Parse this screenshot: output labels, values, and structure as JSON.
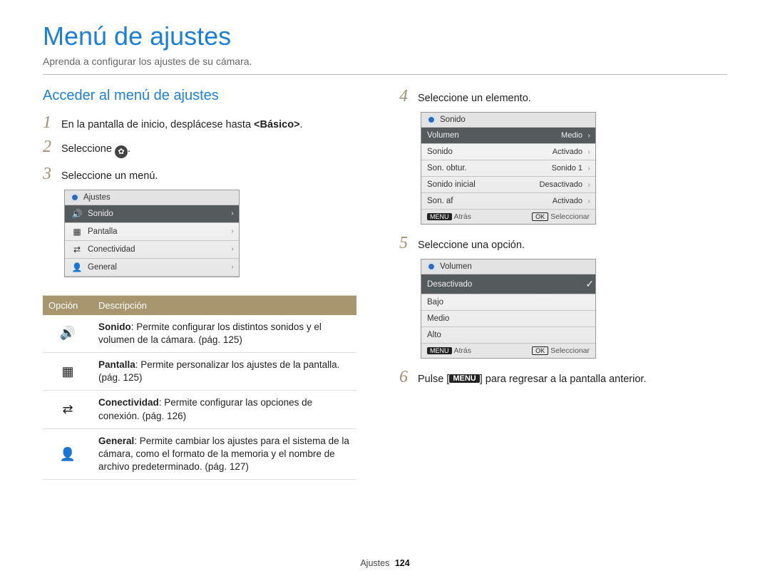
{
  "header": {
    "title": "Menú de ajustes",
    "subtitle": "Aprenda a configurar los ajustes de su cámara."
  },
  "left": {
    "section_title": "Acceder al menú de ajustes",
    "steps": {
      "1": {
        "num": "1",
        "prefix": "En la pantalla de inicio, desplácese hasta ",
        "bold": "<Básico>",
        "suffix": "."
      },
      "2": {
        "num": "2",
        "prefix": "Seleccione ",
        "suffix": "."
      },
      "3": {
        "num": "3",
        "text": "Seleccione un menú."
      }
    },
    "screen1": {
      "header": "Ajustes",
      "rows": {
        "0": {
          "icon": "sound",
          "label": "Sonido"
        },
        "1": {
          "icon": "display",
          "label": "Pantalla"
        },
        "2": {
          "icon": "connect",
          "label": "Conectividad"
        },
        "3": {
          "icon": "general",
          "label": "General"
        }
      }
    },
    "table": {
      "h_option": "Opción",
      "h_desc": "Descripción",
      "rows": {
        "0": {
          "icon": "sound",
          "bold": "Sonido",
          "desc": ": Permite configurar los distintos sonidos y el volumen de la cámara. (pág. 125)"
        },
        "1": {
          "icon": "display",
          "bold": "Pantalla",
          "desc": ": Permite personalizar los ajustes de la pantalla. (pág. 125)"
        },
        "2": {
          "icon": "connect",
          "bold": "Conectividad",
          "desc": ": Permite configurar las opciones de conexión. (pág. 126)"
        },
        "3": {
          "icon": "general",
          "bold": "General",
          "desc": ": Permite cambiar los ajustes para el sistema de la cámara, como el formato de la memoria y el nombre de archivo predeterminado. (pág. 127)"
        }
      }
    }
  },
  "right": {
    "step4": {
      "num": "4",
      "text": "Seleccione un elemento."
    },
    "screen2": {
      "header": "Sonido",
      "rows": {
        "0": {
          "label": "Volumen",
          "value": "Medio",
          "selected": "true"
        },
        "1": {
          "label": "Sonido",
          "value": "Activado"
        },
        "2": {
          "label": "Son. obtur.",
          "value": "Sonido 1"
        },
        "3": {
          "label": "Sonido inicial",
          "value": "Desactivado"
        },
        "4": {
          "label": "Son. af",
          "value": "Activado"
        }
      },
      "back_key": "MENU",
      "back_label": "Atrás",
      "ok_key": "OK",
      "ok_label": "Seleccionar"
    },
    "step5": {
      "num": "5",
      "text": "Seleccione una opción."
    },
    "screen3": {
      "header": "Volumen",
      "rows": {
        "0": {
          "label": "Desactivado",
          "selected": "true",
          "check": "✓"
        },
        "1": {
          "label": "Bajo"
        },
        "2": {
          "label": "Medio"
        },
        "3": {
          "label": "Alto"
        }
      },
      "back_key": "MENU",
      "back_label": "Atrás",
      "ok_key": "OK",
      "ok_label": "Seleccionar"
    },
    "step6": {
      "num": "6",
      "prefix": "Pulse [",
      "btn": "MENU",
      "suffix": "] para regresar a la pantalla anterior."
    }
  },
  "footer": {
    "section": "Ajustes",
    "page": "124"
  },
  "icons": {
    "sound": "🔊",
    "display": "▦",
    "connect": "⇄",
    "general": "👤"
  }
}
